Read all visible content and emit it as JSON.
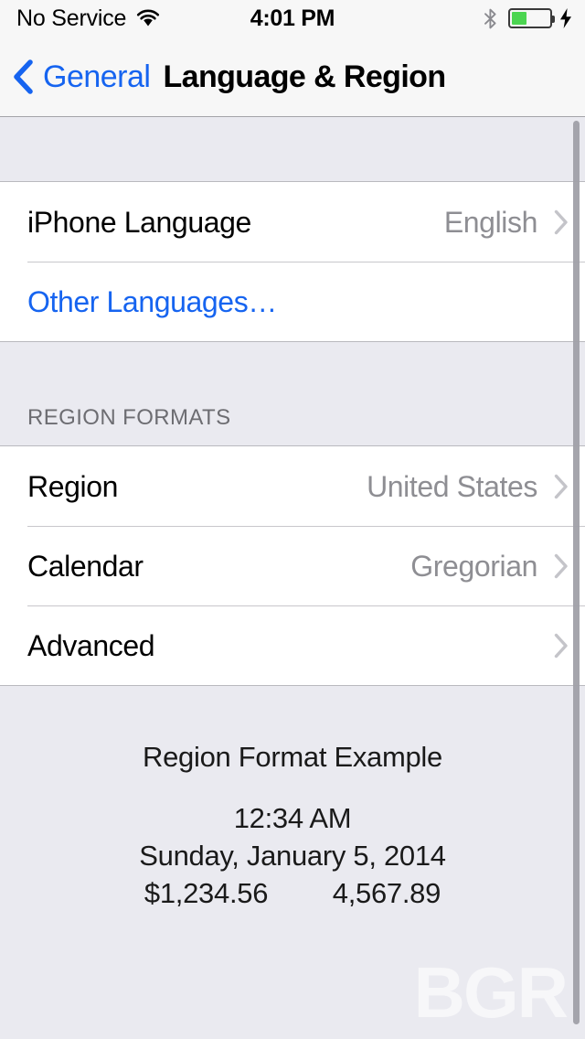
{
  "status_bar": {
    "carrier": "No Service",
    "wifi_icon": "wifi-icon",
    "time": "4:01 PM",
    "bluetooth_icon": "bluetooth-icon",
    "battery_icon": "battery-icon",
    "battery_level_percent": 40,
    "charging_icon": "lightning-bolt-icon"
  },
  "nav": {
    "back_icon": "chevron-left-icon",
    "back_label": "General",
    "title": "Language & Region"
  },
  "sections": [
    {
      "header": "",
      "rows": [
        {
          "label": "iPhone Language",
          "value": "English",
          "chevron": true,
          "is_link": false,
          "name": "row-iphone-language"
        },
        {
          "label": "Other Languages…",
          "value": "",
          "chevron": false,
          "is_link": true,
          "name": "row-other-languages"
        }
      ]
    },
    {
      "header": "REGION FORMATS",
      "rows": [
        {
          "label": "Region",
          "value": "United States",
          "chevron": true,
          "is_link": false,
          "name": "row-region"
        },
        {
          "label": "Calendar",
          "value": "Gregorian",
          "chevron": true,
          "is_link": false,
          "name": "row-calendar"
        },
        {
          "label": "Advanced",
          "value": "",
          "chevron": true,
          "is_link": false,
          "name": "row-advanced"
        }
      ]
    }
  ],
  "footer": {
    "title": "Region Format Example",
    "time": "12:34 AM",
    "date": "Sunday, January 5, 2014",
    "currency": "$1,234.56",
    "number": "4,567.89"
  },
  "watermark": "BGR",
  "colors": {
    "accent_blue": "#1664F0",
    "group_background": "#EAEAF0",
    "row_background": "#FFFFFF",
    "value_gray": "#8E8E93",
    "header_gray": "#6D6D72",
    "battery_green": "#4CD551"
  }
}
